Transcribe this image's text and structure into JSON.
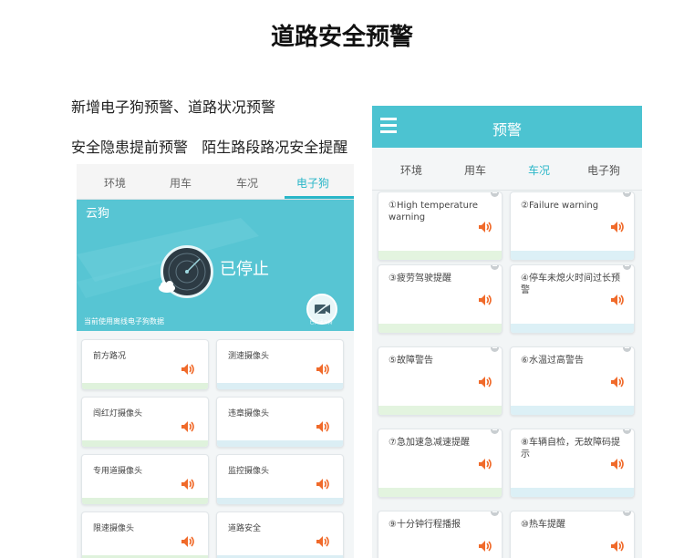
{
  "page": {
    "title": "道路安全预警",
    "intro_line1": "新增电子狗预警、道路状况预警",
    "intro_line2": "安全隐患提前预警   陌生路段路况安全提醒"
  },
  "left_screen": {
    "tabs": [
      "环境",
      "用车",
      "车况",
      "电子狗"
    ],
    "active_tab": "电子狗",
    "panel": {
      "title": "云狗",
      "status": "已停止",
      "note": "当前使用离线电子狗数据",
      "button_label": "已关闭云狗"
    },
    "cards": [
      {
        "label": "前方路况",
        "bar_color": "#dff2dc"
      },
      {
        "label": "测速摄像头",
        "bar_color": "#dbeef4"
      },
      {
        "label": "闯红灯摄像头",
        "bar_color": "#dff2dc"
      },
      {
        "label": "违章摄像头",
        "bar_color": "#dbeef4"
      },
      {
        "label": "专用道摄像头",
        "bar_color": "#dff2dc"
      },
      {
        "label": "监控摄像头",
        "bar_color": "#dbeef4"
      },
      {
        "label": "限速摄像头",
        "bar_color": "#dff2dc"
      },
      {
        "label": "道路安全",
        "bar_color": "#dbeef4"
      }
    ]
  },
  "right_screen": {
    "title": "预警",
    "menu_icon": "hamburger-menu-icon",
    "tabs": [
      "环境",
      "用车",
      "车况",
      "电子狗"
    ],
    "active_tab": "车况",
    "cards": [
      {
        "label": "①High temperature warning",
        "bar_color": "#e3f4df"
      },
      {
        "label": "②Failure warning",
        "bar_color": "#dcf0f6"
      },
      {
        "label": "③疲劳驾驶提醒",
        "bar_color": "#e3f4df"
      },
      {
        "label": "④停车未熄火时间过长预警",
        "bar_color": "#dcf0f6"
      },
      {
        "label": "⑤故障警告",
        "bar_color": "#e3f4df"
      },
      {
        "label": "⑥水温过高警告",
        "bar_color": "#dcf0f6"
      },
      {
        "label": "⑦急加速急减速提醒",
        "bar_color": "#e3f4df"
      },
      {
        "label": "⑧车辆自检，无故障码提示",
        "bar_color": "#dcf0f6"
      },
      {
        "label": "⑨十分钟行程播报",
        "bar_color": "#e3f4df"
      },
      {
        "label": "⑩热车提醒",
        "bar_color": "#dcf0f6"
      }
    ]
  },
  "colors": {
    "accent": "#4cc3d1",
    "speaker": "#f06a2a"
  }
}
